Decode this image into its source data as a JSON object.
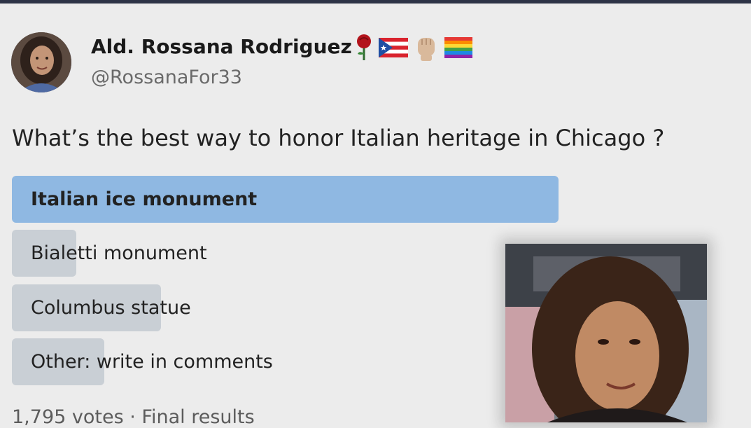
{
  "tweet": {
    "author": {
      "name": "Ald. Rossana Rodriguez",
      "handle": "@RossanaFor33",
      "badges": [
        "rose-icon",
        "puerto-rico-flag-icon",
        "raised-fist-icon",
        "rainbow-flag-icon"
      ]
    },
    "text": "What’s the best way to honor Italian heritage in Chicago ?",
    "poll": {
      "options": [
        {
          "label": "Italian ice monument",
          "winner": true
        },
        {
          "label": "Bialetti monument",
          "winner": false
        },
        {
          "label": "Columbus statue",
          "winner": false
        },
        {
          "label": "Other: write in comments",
          "winner": false
        }
      ],
      "footer": "1,795 votes · Final results"
    }
  },
  "colors": {
    "winner_bar": "#8fb8e2",
    "other_bar": "#c9cfd5",
    "background": "#ececec"
  }
}
